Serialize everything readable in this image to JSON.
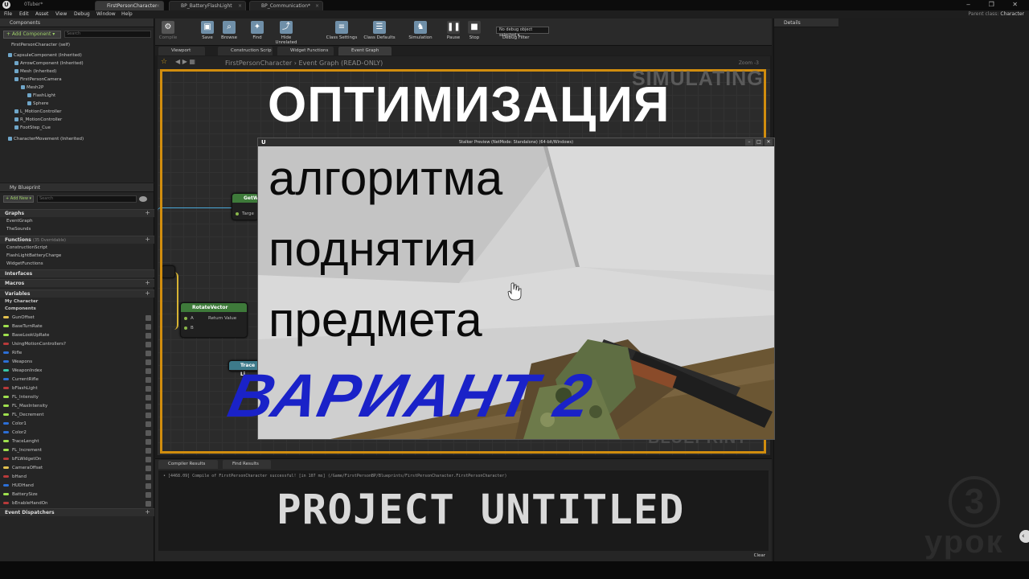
{
  "window": {
    "project_name": "0Tuber*",
    "doc_tabs": [
      {
        "label": "FirstPersonCharacter"
      },
      {
        "label": "BP_BatteryFlashLight"
      },
      {
        "label": "BP_Communication*"
      }
    ],
    "controls": "‒ ❐ ✕"
  },
  "menu": {
    "items": [
      "File",
      "Edit",
      "Asset",
      "View",
      "Debug",
      "Window",
      "Help"
    ],
    "parent_class_label": "Parent class:",
    "parent_class_value": "Character"
  },
  "components_panel": {
    "tab": "Components",
    "add_button": "+ Add Component ▾",
    "search_placeholder": "Search",
    "self": "FirstPersonCharacter (self)",
    "tree": [
      "CapsuleComponent (Inherited)",
      "ArrowComponent (Inherited)",
      "Mesh (Inherited)",
      "FirstPersonCamera",
      "Mesh2P",
      "FlashLight",
      "Sphere",
      "L_MotionController",
      "R_MotionController",
      "FootStep_Cue",
      "CharacterMovement (Inherited)"
    ]
  },
  "my_blueprint": {
    "tab": "My Blueprint",
    "add_new": "+ Add New ▾",
    "search_placeholder": "Search",
    "graphs_label": "Graphs",
    "graphs": [
      "EventGraph",
      "TheSounds"
    ],
    "functions_label": "Functions",
    "functions_count": "(35 Overridable)",
    "functions": [
      "ConstructionScript",
      "FlashLightBatteryCharge",
      "WidgetFunctions"
    ],
    "interfaces_label": "Interfaces",
    "macros_label": "Macros",
    "variables_label": "Variables",
    "my_character_label": "My Character",
    "components_label": "Components",
    "variables": [
      "GunOffset",
      "BaseTurnRate",
      "BaseLookUpRate",
      "UsingMotionControllers?",
      "Rifle",
      "Weapons",
      "WeaponIndex",
      "CurrentRifle",
      "bFlashLight",
      "FL_Intensity",
      "FL_MaxIntensity",
      "FL_Decrement",
      "Color1",
      "Color2",
      "TraceLenght",
      "FL_Increment",
      "bFLWidgetOn",
      "CameraOffset",
      "bHand",
      "HUDHand",
      "BatterySize",
      "bEnableHandOn"
    ],
    "dispatchers_label": "Event Dispatchers"
  },
  "toolbar": {
    "compile": "Compile",
    "save": "Save",
    "browse": "Browse",
    "find": "Find",
    "hide_unrelated": "Hide Unrelated",
    "class_settings": "Class Settings",
    "class_defaults": "Class Defaults",
    "simulation": "Simulation",
    "pause": "Pause",
    "stop": "Stop",
    "debug_select": "No debug object selected ▾",
    "debug_filter": "Debug Filter"
  },
  "editor_tabs": [
    "Viewport",
    "Construction Scrip",
    "Widget Functions",
    "Event Graph"
  ],
  "breadcrumb": {
    "path": "FirstPersonCharacter  ›  Event Graph",
    "status": "(READ-ONLY)",
    "zoom": "Zoom -3"
  },
  "graph": {
    "simulating": "SIMULATING",
    "watermark": "BLUEPRINT",
    "node_getw": {
      "title": "GetW",
      "pin": "Targe"
    },
    "node_rotate": {
      "title": "RotateVector",
      "pin_a": "A",
      "pin_b": "B",
      "ret": "Return Value"
    },
    "node_trace": {
      "title": "Trace Li"
    }
  },
  "bottom": {
    "tab_compiler": "Compiler Results",
    "tab_find": "Find Results",
    "log_line": "• [4468.09] Compile of FirstPersonCharacter successful! [in 107 ms] (/Game/FirstPersonBP/Blueprints/FirstPersonCharacter.FirstPersonCharacter)",
    "clear": "Clear"
  },
  "details": {
    "tab": "Details"
  },
  "preview": {
    "title": "Stalker Preview (NetMode: Standalone) (64-bit/Windows)",
    "ue_mark": "U",
    "btn_min": "–",
    "btn_max": "□",
    "btn_close": "✕"
  },
  "overlay": {
    "title": "ОПТИМИЗАЦИЯ",
    "line1": "алгоритма",
    "line2": "поднятия",
    "line3": "предмета",
    "variant": "ВАРИАНТ 2",
    "project": "PROJECT UNTITLED",
    "brand_digit": "3",
    "brand_word": "урок"
  },
  "colors": {
    "graph_border": "#d18d0e",
    "variant_text": "#1a22c8",
    "function_node_header": "#3e7a3a"
  },
  "icons": [
    "unreal-logo-icon",
    "search-icon",
    "eye-icon",
    "plus-icon",
    "save-icon",
    "browse-icon",
    "find-icon",
    "hide-unrelated-icon",
    "class-settings-icon",
    "class-defaults-icon",
    "simulation-icon",
    "pause-icon",
    "stop-icon",
    "star-icon",
    "hand-cursor-icon"
  ]
}
